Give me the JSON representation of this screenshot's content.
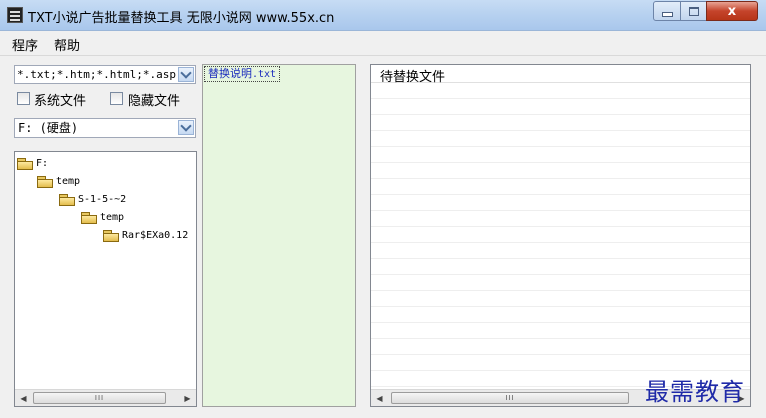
{
  "window": {
    "title": "TXT小说广告批量替换工具  无限小说网 www.55x.cn",
    "close_glyph": "x"
  },
  "menu": [
    "程序",
    "帮助"
  ],
  "left_panel": {
    "file_filter": "*.txt;*.htm;*.html;*.asp",
    "checkbox_system": {
      "label": "系统文件",
      "checked": false
    },
    "checkbox_hidden": {
      "label": "隐藏文件",
      "checked": false
    },
    "drive": "F: (硬盘)",
    "tree": [
      "F:",
      "temp",
      "S-1-5-~2",
      "temp",
      "Rar$EXa0.12"
    ],
    "scroll_thumb": "III"
  },
  "middle_panel": {
    "file_prefix": "替换说明",
    "file_ext": ".txt"
  },
  "right_panel": {
    "header": "待替换文件",
    "scroll_thumb": "III"
  },
  "watermark": "最需教育"
}
